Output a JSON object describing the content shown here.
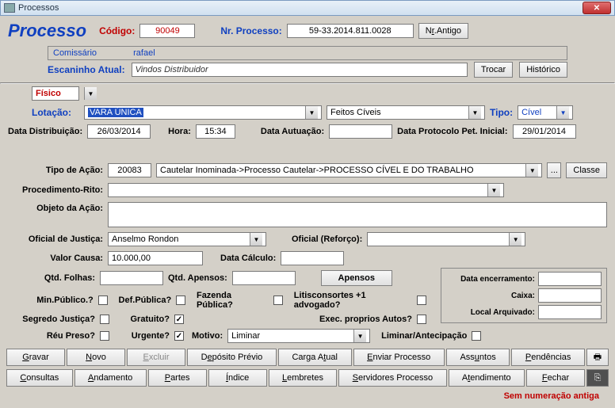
{
  "window": {
    "title": "Processos"
  },
  "header": {
    "app": "Processo",
    "codigo_label": "Código:",
    "codigo": "90049",
    "nrproc_label": "Nr. Processo:",
    "nrproc": "59-33.2014.811.0028",
    "nrantigo_btn": "Nr.Antigo"
  },
  "comissario": {
    "label": "Comissário",
    "name": "rafael"
  },
  "escaninho": {
    "label": "Escaninho Atual:",
    "value": "Vindos Distribuidor",
    "trocar": "Trocar",
    "historico": "Histórico"
  },
  "fisico": {
    "value": "Físico"
  },
  "lotacao": {
    "label": "Lotação:",
    "value": "VARA ÚNICA",
    "feitos": "Feitos Cíveis",
    "tipo_label": "Tipo:",
    "tipo": "Cível"
  },
  "datas": {
    "dist_label": "Data Distribuição:",
    "dist": "26/03/2014",
    "hora_label": "Hora:",
    "hora": "15:34",
    "aut_label": "Data Autuação:",
    "aut": "",
    "prot_label": "Data Protocolo Pet. Inicial:",
    "prot": "29/01/2014"
  },
  "acao": {
    "tipo_label": "Tipo de Ação:",
    "codigo": "20083",
    "desc": "Cautelar Inominada->Processo Cautelar->PROCESSO CÍVEL E DO TRABALHO",
    "dots": "...",
    "classe": "Classe"
  },
  "proc_rito": {
    "label": "Procedimento-Rito:",
    "value": ""
  },
  "objeto": {
    "label": "Objeto da Ação:",
    "value": ""
  },
  "oficial": {
    "label": "Oficial de Justiça:",
    "value": "Anselmo Rondon",
    "reforco_label": "Oficial (Reforço):",
    "reforco": ""
  },
  "valor": {
    "label": "Valor Causa:",
    "value": "10.000,00",
    "datacalc_label": "Data Cálculo:",
    "datacalc": ""
  },
  "folhas": {
    "label": "Qtd. Folhas:",
    "value": "",
    "apensos_label": "Qtd. Apensos:",
    "apensos_value": "",
    "apensos_btn": "Apensos"
  },
  "enc": {
    "data_label": "Data encerramento:",
    "data": "",
    "caixa_label": "Caixa:",
    "caixa": "",
    "local_label": "Local Arquivado:",
    "local": ""
  },
  "checks": {
    "minpub": "Min.Público.?",
    "defpub": "Def.Pública?",
    "fazpub": "Fazenda Pública?",
    "litis": "Litisconsortes +1 advogado?",
    "segredo": "Segredo Justiça?",
    "gratuito": "Gratuito?",
    "execprop": "Exec. proprios Autos?",
    "reu": "Réu Preso?",
    "urgente": "Urgente?",
    "motivo_label": "Motivo:",
    "motivo": "Liminar",
    "liminar": "Liminar/Antecipação"
  },
  "buttons": {
    "gravar": "Gravar",
    "novo": "Novo",
    "excluir": "Excluir",
    "deposito": "Depósito Prévio",
    "carga": "Carga Atual",
    "enviar": "Enviar Processo",
    "assuntos": "Assuntos",
    "pendencias": "Pendências",
    "consultas": "Consultas",
    "andamento": "Andamento",
    "partes": "Partes",
    "indice": "Índice",
    "lembretes": "Lembretes",
    "servidores": "Servidores Processo",
    "atendimento": "Atendimento",
    "fechar": "Fechar"
  },
  "footer": {
    "msg": "Sem numeração antiga"
  }
}
